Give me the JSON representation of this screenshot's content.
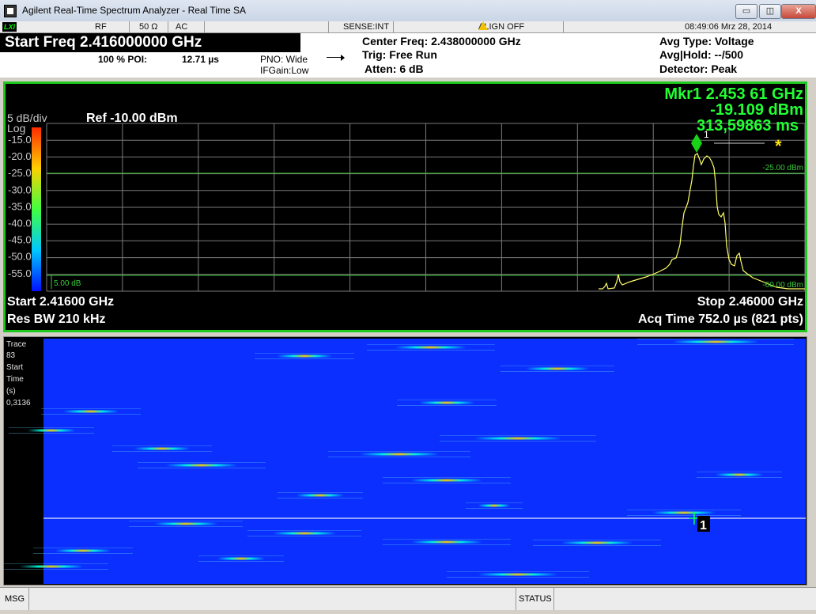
{
  "window": {
    "title": "Agilent Real-Time Spectrum Analyzer - Real Time SA",
    "min_label": "▭",
    "max_label": "◫",
    "close_label": "X"
  },
  "status_bar": {
    "lxi": "LXI",
    "rf": "RF",
    "impedance": "50 Ω",
    "coupling": "AC",
    "sense": "SENSE:INT",
    "align": "ALIGN OFF",
    "datetime": "08:49:06 Mrz 28, 2014"
  },
  "settings": {
    "start_freq_banner": "Start Freq 2.416000000 GHz",
    "poi": "100 % POI:",
    "poi_time": "12.71 µs",
    "pno": "PNO: Wide",
    "ifgain": "IFGain:Low",
    "center_freq": "Center Freq: 2.438000000 GHz",
    "trig": "Trig: Free Run",
    "atten": "Atten: 6 dB",
    "avg_type": "Avg Type: Voltage",
    "avg_hold": "Avg|Hold: --/500",
    "detector": "Detector: Peak"
  },
  "spectrum": {
    "scale": "5 dB/div",
    "ref": "Ref -10.00 dBm",
    "log": "Log",
    "y_ticks": [
      "-15.0",
      "-20.0",
      "-25.0",
      "-30.0",
      "-35.0",
      "-40.0",
      "-45.0",
      "-50.0",
      "-55.0"
    ],
    "line_label_upper": "-25.00 dBm",
    "line_label_lower": "-60.00 dBm",
    "bottom_left_marker": "5.00 dB",
    "marker_readout_1": "Mkr1 2.453 61 GHz",
    "marker_readout_2": "-19.109 dBm",
    "marker_readout_3": "313,59863 ms",
    "marker_flag": "1",
    "star_symbol": "*",
    "start": "Start 2.41600 GHz",
    "stop": "Stop 2.46000 GHz",
    "res_bw": "Res BW 210 kHz",
    "acq_time": "Acq Time  752.0 µs (821 pts)",
    "color_accent": "#00ff3a",
    "trace_color": "#ffff66"
  },
  "waterfall": {
    "labels": [
      "Trace",
      "83",
      "Start",
      "Time",
      "(s)",
      "0,3136"
    ],
    "marker_label": "1",
    "background_color": "#0a2fff"
  },
  "bottom_bar": {
    "msg": "MSG",
    "status": "STATUS"
  }
}
